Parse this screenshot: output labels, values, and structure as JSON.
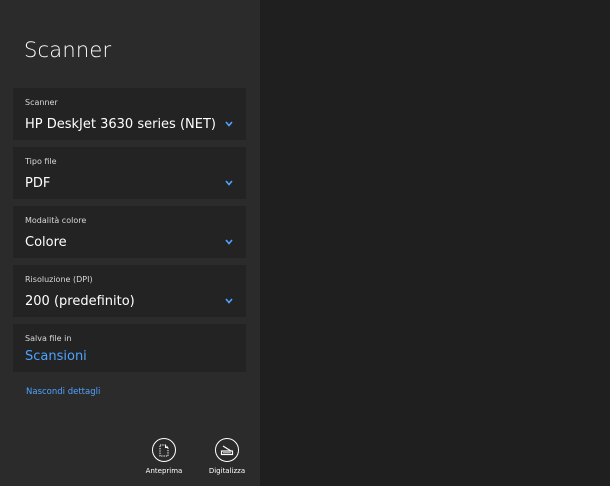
{
  "app": {
    "title": "Scanner"
  },
  "fields": {
    "scanner": {
      "label": "Scanner",
      "value": "HP DeskJet 3630 series (NET)"
    },
    "file_type": {
      "label": "Tipo file",
      "value": "PDF"
    },
    "color_mode": {
      "label": "Modalità colore",
      "value": "Colore"
    },
    "resolution": {
      "label": "Risoluzione (DPI)",
      "value": "200 (predefinito)"
    },
    "save_to": {
      "label": "Salva file in",
      "value": "Scansioni"
    }
  },
  "links": {
    "hide_details": "Nascondi dettagli"
  },
  "actions": {
    "preview": {
      "label": "Anteprima",
      "icon": "document-preview-icon"
    },
    "scan": {
      "label": "Digitalizza",
      "icon": "scanner-icon"
    }
  },
  "colors": {
    "accent": "#4ea3ff",
    "left_pane": "#2b2b2b",
    "card": "#232323",
    "right_pane": "#1f1f1f"
  }
}
